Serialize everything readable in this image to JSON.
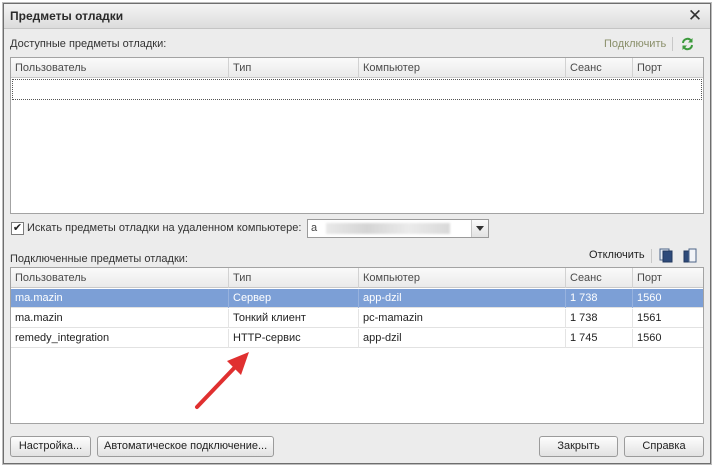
{
  "window": {
    "title": "Предметы отладки",
    "close": "✕"
  },
  "available": {
    "label": "Доступные предметы отладки:",
    "connect_label": "Подключить",
    "columns": [
      "Пользователь",
      "Тип",
      "Компьютер",
      "Сеанс",
      "Порт"
    ]
  },
  "search_remote": {
    "checked": true,
    "check_mark": "✔",
    "label": "Искать предметы отладки на удаленном компьютере:",
    "value_prefix": "a"
  },
  "connected": {
    "label": "Подключенные предметы отладки:",
    "disconnect_label": "Отключить",
    "columns": [
      "Пользователь",
      "Тип",
      "Компьютер",
      "Сеанс",
      "Порт"
    ],
    "rows": [
      {
        "user": "ma.mazin",
        "type": "Сервер",
        "computer": "app-dzil",
        "session": "1 738",
        "port": "1560",
        "selected": true
      },
      {
        "user": "ma.mazin",
        "type": "Тонкий клиент",
        "computer": "pc-mamazin",
        "session": "1 738",
        "port": "1561",
        "selected": false
      },
      {
        "user": "remedy_integration",
        "type": "HTTP-сервис",
        "computer": "app-dzil",
        "session": "1 745",
        "port": "1560",
        "selected": false
      }
    ]
  },
  "buttons": {
    "settings": "Настройка...",
    "auto_connect": "Автоматическое подключение...",
    "close": "Закрыть",
    "help": "Справка"
  },
  "colors": {
    "selection": "#7c9fd6",
    "arrow": "#e03030",
    "refresh_icon": "#3d9a3d"
  },
  "icons": {
    "refresh": "refresh-icon",
    "copy": "copy-icon",
    "copy_alt": "copy-alt-icon",
    "close": "close-icon",
    "arrow": "red-arrow-annotation"
  }
}
